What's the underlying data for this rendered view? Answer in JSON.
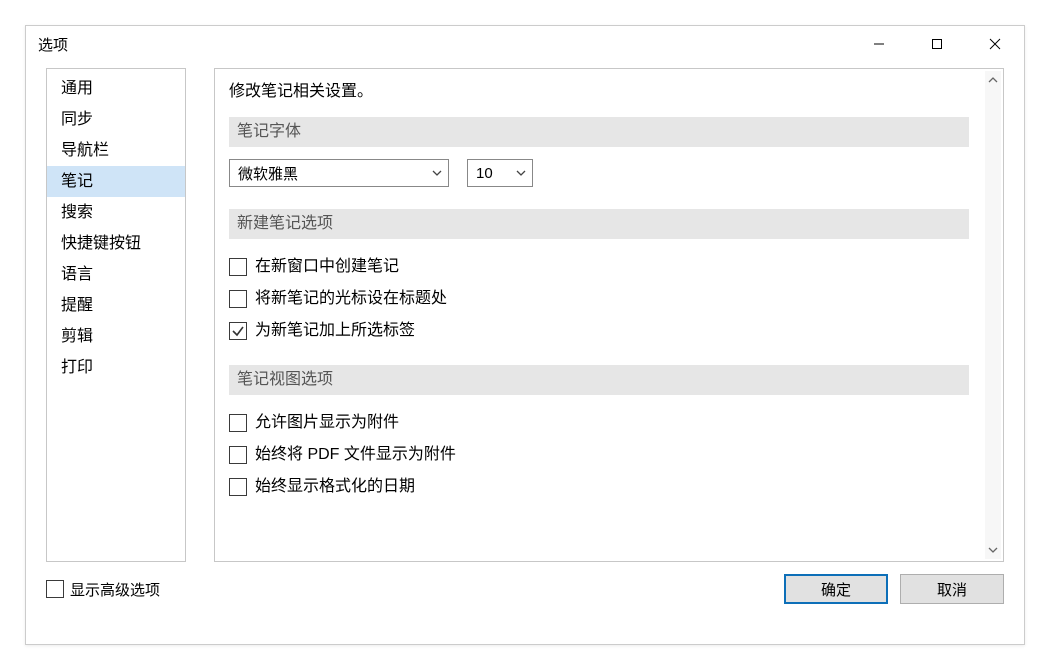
{
  "window": {
    "title": "选项"
  },
  "sidebar": {
    "items": [
      {
        "label": "通用"
      },
      {
        "label": "同步"
      },
      {
        "label": "导航栏"
      },
      {
        "label": "笔记"
      },
      {
        "label": "搜索"
      },
      {
        "label": "快捷键按钮"
      },
      {
        "label": "语言"
      },
      {
        "label": "提醒"
      },
      {
        "label": "剪辑"
      },
      {
        "label": "打印"
      }
    ],
    "selected_index": 3
  },
  "main": {
    "description": "修改笔记相关设置。",
    "font_section": {
      "header": "笔记字体",
      "font_value": "微软雅黑",
      "size_value": "10"
    },
    "newnote_section": {
      "header": "新建笔记选项",
      "options": [
        {
          "label": "在新窗口中创建笔记",
          "checked": false
        },
        {
          "label": "将新笔记的光标设在标题处",
          "checked": false
        },
        {
          "label": "为新笔记加上所选标签",
          "checked": true
        }
      ]
    },
    "view_section": {
      "header": "笔记视图选项",
      "options": [
        {
          "label": "允许图片显示为附件",
          "checked": false
        },
        {
          "label": "始终将 PDF 文件显示为附件",
          "checked": false
        },
        {
          "label": "始终显示格式化的日期",
          "checked": false
        }
      ]
    }
  },
  "footer": {
    "advanced_label": "显示高级选项",
    "advanced_checked": false,
    "ok_label": "确定",
    "cancel_label": "取消"
  }
}
